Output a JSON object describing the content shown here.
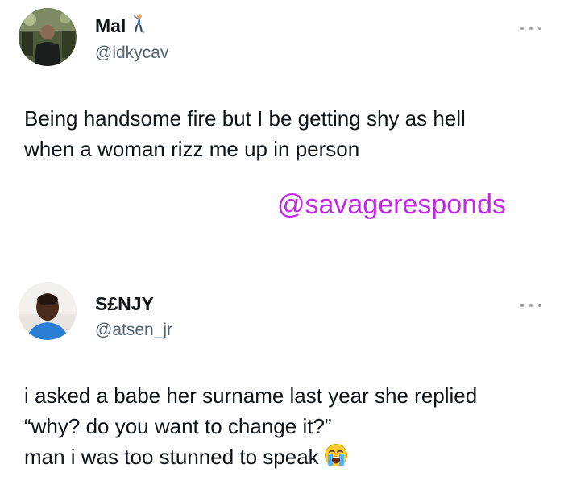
{
  "posts": [
    {
      "display_name": "Mal",
      "handle": "@idkycav",
      "text": "Being handsome fire but I be getting shy as hell\nwhen a woman rizz me up in person",
      "name_icon": "golfer-icon",
      "more_icon": "more-options-icon"
    },
    {
      "display_name": "S£NJY",
      "handle": "@atsen_jr",
      "text": "i asked a babe her surname last year she replied\n“why? do you want to change it?”\nman i was too stunned to speak",
      "trailing_emoji": "crying-face-icon",
      "more_icon": "more-options-icon"
    }
  ],
  "watermark": {
    "text": "@savageresponds",
    "color": "#c327e8"
  },
  "colors": {
    "text": "#0f1419",
    "handle": "#536471",
    "more_dots": "#9aa4ad"
  }
}
